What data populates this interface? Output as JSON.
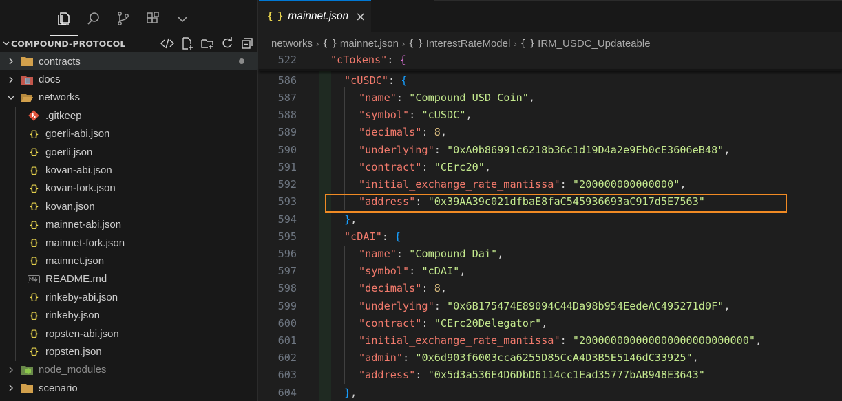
{
  "explorer": {
    "title": "COMPOUND-PROTOCOL",
    "items": [
      {
        "label": "contracts",
        "icon": "folder-icon",
        "type": "folder",
        "state": "collapsed"
      },
      {
        "label": "docs",
        "icon": "docs-folder-icon",
        "type": "folder",
        "state": "collapsed"
      },
      {
        "label": "networks",
        "icon": "folder-open-icon",
        "type": "folder",
        "state": "expanded"
      },
      {
        "label": ".gitkeep",
        "icon": "git-icon",
        "type": "file"
      },
      {
        "label": "goerli-abi.json",
        "icon": "json-icon",
        "type": "file"
      },
      {
        "label": "goerli.json",
        "icon": "json-icon",
        "type": "file"
      },
      {
        "label": "kovan-abi.json",
        "icon": "json-icon",
        "type": "file"
      },
      {
        "label": "kovan-fork.json",
        "icon": "json-icon",
        "type": "file"
      },
      {
        "label": "kovan.json",
        "icon": "json-icon",
        "type": "file"
      },
      {
        "label": "mainnet-abi.json",
        "icon": "json-icon",
        "type": "file"
      },
      {
        "label": "mainnet-fork.json",
        "icon": "json-icon",
        "type": "file"
      },
      {
        "label": "mainnet.json",
        "icon": "json-icon",
        "type": "file"
      },
      {
        "label": "README.md",
        "icon": "markdown-icon",
        "type": "file"
      },
      {
        "label": "rinkeby-abi.json",
        "icon": "json-icon",
        "type": "file"
      },
      {
        "label": "rinkeby.json",
        "icon": "json-icon",
        "type": "file"
      },
      {
        "label": "ropsten-abi.json",
        "icon": "json-icon",
        "type": "file"
      },
      {
        "label": "ropsten.json",
        "icon": "json-icon",
        "type": "file"
      },
      {
        "label": "node_modules",
        "icon": "node-folder-icon",
        "type": "folder",
        "state": "collapsed"
      },
      {
        "label": "scenario",
        "icon": "folder-icon",
        "type": "folder",
        "state": "collapsed"
      }
    ]
  },
  "tab": {
    "icon": "{ }",
    "label": "mainnet.json",
    "close": "×"
  },
  "breadcrumb": [
    "networks",
    "mainnet.json",
    "InterestRateModel",
    "IRM_USDC_Updateable"
  ],
  "breadcrumb_icon": "{ }",
  "code": {
    "line_numbers": [
      "522",
      "586",
      "587",
      "588",
      "589",
      "590",
      "591",
      "592",
      "593",
      "594",
      "595",
      "596",
      "597",
      "598",
      "599",
      "600",
      "601",
      "602",
      "603",
      "604"
    ],
    "sticky": {
      "key": "\"cTokens\"",
      "text": ": {"
    },
    "cusdc_key": "\"cUSDC\"",
    "cusdc": [
      {
        "k": "\"name\"",
        "v": "\"Compound USD Coin\""
      },
      {
        "k": "\"symbol\"",
        "v": "\"cUSDC\""
      },
      {
        "k": "\"decimals\"",
        "v": "8"
      },
      {
        "k": "\"underlying\"",
        "v": "\"0xA0b86991c6218b36c1d19D4a2e9Eb0cE3606eB48\""
      },
      {
        "k": "\"contract\"",
        "v": "\"CErc20\""
      },
      {
        "k": "\"initial_exchange_rate_mantissa\"",
        "v": "\"200000000000000\""
      },
      {
        "k": "\"address\"",
        "v": "\"0x39AA39c021dfbaE8faC545936693aC917d5E7563\""
      }
    ],
    "cdai_key": "\"cDAI\"",
    "cdai": [
      {
        "k": "\"name\"",
        "v": "\"Compound Dai\""
      },
      {
        "k": "\"symbol\"",
        "v": "\"cDAI\""
      },
      {
        "k": "\"decimals\"",
        "v": "8"
      },
      {
        "k": "\"underlying\"",
        "v": "\"0x6B175474E89094C44Da98b954EedeAC495271d0F\""
      },
      {
        "k": "\"contract\"",
        "v": "\"CErc20Delegator\""
      },
      {
        "k": "\"initial_exchange_rate_mantissa\"",
        "v": "\"200000000000000000000000000\""
      },
      {
        "k": "\"admin\"",
        "v": "\"0x6d903f6003cca6255D85CcA4D3B5E5146dC33925\""
      },
      {
        "k": "\"address\"",
        "v": "\"0x5d3a536E4D6DbD6114cc1Ead35777bAB948E3643\""
      }
    ]
  },
  "colors": {
    "accent": "#0078d4",
    "highlight_box": "#f08a24",
    "json_icon": "#e8d44d"
  }
}
